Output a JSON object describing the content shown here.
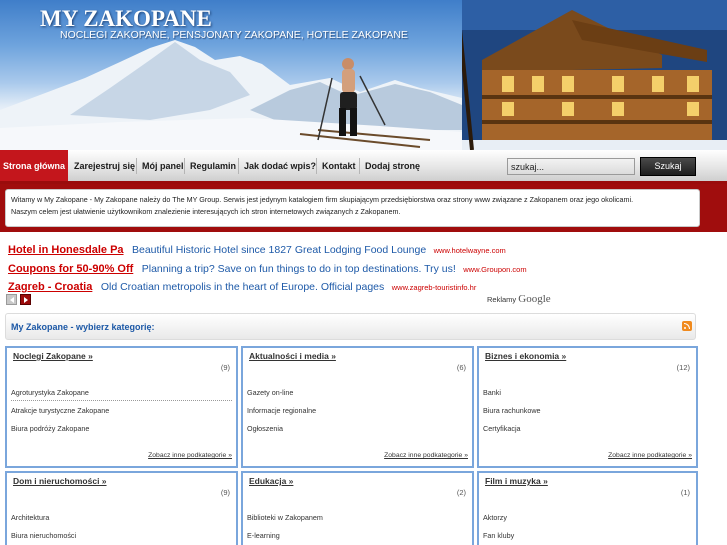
{
  "header": {
    "title": "MY ZAKOPANE",
    "subtitle": "NOCLEGI ZAKOPANE, PENSJONATY ZAKOPANE, HOTELE ZAKOPANE"
  },
  "nav": {
    "items": [
      {
        "label": "Strona główna"
      },
      {
        "label": "Zarejestruj się"
      },
      {
        "label": "Mój panel"
      },
      {
        "label": "Regulamin"
      },
      {
        "label": "Jak dodać wpis?"
      },
      {
        "label": "Kontakt"
      },
      {
        "label": "Dodaj stronę"
      }
    ],
    "search_value": "szukaj...",
    "search_button": "Szukaj"
  },
  "welcome": {
    "line1": "Witamy w My Zakopane - My Zakopane należy do The MY Group. Serwis jest jedynym katalogiem firm skupiającym przedsiębiorstwa oraz strony www związane z Zakopanem oraz jego okolicami.",
    "line2": "Naszym celem jest ułatwienie użytkownikom znalezienie interesujących ich stron internetowych związanych z Zakopanem."
  },
  "ads": {
    "items": [
      {
        "title": "Hotel in Honesdale Pa",
        "desc": "Beautiful Historic Hotel since 1827 Great Lodging Food Lounge",
        "url": "www.hotelwayne.com"
      },
      {
        "title": "Coupons for 50-90% Off",
        "desc": "Planning a trip? Save on fun things to do in top destinations. Try us!",
        "url": "www.Groupon.com"
      },
      {
        "title": "Zagreb - Croatia",
        "desc": "Old Croatian metropolis in the heart of Europe. Official pages",
        "url": "www.zagreb-touristinfo.hr"
      }
    ],
    "ads_by": "Reklamy",
    "ads_brand": "Google"
  },
  "categories_header": {
    "title": "My Zakopane - wybierz kategorię:"
  },
  "categories": [
    {
      "name": "Noclegi Zakopane »",
      "count": "(9)",
      "subs": [
        "Agroturystyka Zakopane",
        "Atrakcje turystyczne Zakopane",
        "Biura podróży Zakopane"
      ],
      "more": "Zobacz inne podkategorie »"
    },
    {
      "name": "Aktualności i media »",
      "count": "(6)",
      "subs": [
        "Gazety on-line",
        "Informacje regionalne",
        "Ogłoszenia"
      ],
      "more": "Zobacz inne podkategorie »"
    },
    {
      "name": "Biznes i ekonomia »",
      "count": "(12)",
      "subs": [
        "Banki",
        "Biura rachunkowe",
        "Certyfikacja"
      ],
      "more": "Zobacz inne podkategorie »"
    },
    {
      "name": "Dom i nieruchomości »",
      "count": "(9)",
      "subs": [
        "Architektura",
        "Biura nieruchomości"
      ]
    },
    {
      "name": "Edukacja »",
      "count": "(2)",
      "subs": [
        "Biblioteki w Zakopanem",
        "E-learning"
      ]
    },
    {
      "name": "Film i muzyka »",
      "count": "(1)",
      "subs": [
        "Aktorzy",
        "Fan kluby"
      ]
    }
  ]
}
